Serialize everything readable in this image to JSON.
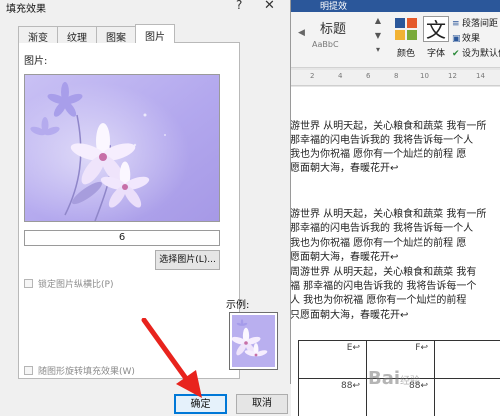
{
  "word": {
    "titlebar_text": "明提效",
    "ribbon": {
      "style_title": "标题",
      "style_sample": "AaBbC",
      "color_label": "颜色",
      "font_label": "字体",
      "font_glyph": "文",
      "para_spacing": "段落间距",
      "effects": "效果",
      "set_default": "设为默认值"
    },
    "ruler_numbers": [
      "2",
      "4",
      "6",
      "8",
      "10",
      "12",
      "14"
    ],
    "document_lines": [
      "游世界  从明天起，关心粮食和蔬菜  我有一所",
      "那幸福的闪电告诉我的  我将告诉每一个人",
      "我也为你祝福  愿你有一个灿烂的前程  愿",
      "愿面朝大海，春暖花开↩",
      "",
      "游世界  从明天起，关心粮食和蔬菜  我有一所",
      "那幸福的闪电告诉我的  我将告诉每一个人",
      "我也为你祝福  愿你有一个灿烂的前程  愿",
      "愿面朝大海，春暖花开↩",
      "周游世界  从明天起，关心粮食和蔬菜  我有",
      "福  那幸福的闪电告诉我的  我将告诉每一个",
      "人  我也为你祝福  愿你有一个灿烂的前程",
      "只愿面朝大海，春暖花开↩"
    ],
    "table_cells": [
      "E↩",
      "F↩",
      "",
      "88↩",
      "88↩",
      ""
    ]
  },
  "dialog": {
    "title": "填充效果",
    "help": "?",
    "close": "✕",
    "tabs": [
      {
        "label": "渐变",
        "active": false
      },
      {
        "label": "纹理",
        "active": false
      },
      {
        "label": "图案",
        "active": false
      },
      {
        "label": "图片",
        "active": true
      }
    ],
    "picture_label": "图片:",
    "picture_number": "6",
    "select_picture_button": "选择图片(L)...",
    "lock_aspect_checkbox": {
      "label": "锁定图片纵横比(P)",
      "checked": false,
      "enabled": false
    },
    "rotate_with_shape_checkbox": {
      "label": "随图形旋转填充效果(W)",
      "checked": false,
      "enabled": false
    },
    "sample_label": "示例:",
    "ok_button": "确定",
    "cancel_button": "取消"
  },
  "watermark": {
    "main": "Bai",
    "sub": "经验"
  },
  "colors": {
    "word_blue": "#2b579a",
    "dialog_bg": "#f0f0f0",
    "ok_border": "#0078d7",
    "annotation_arrow": "#e8231d",
    "preview_lavender": "#b8aef0"
  }
}
